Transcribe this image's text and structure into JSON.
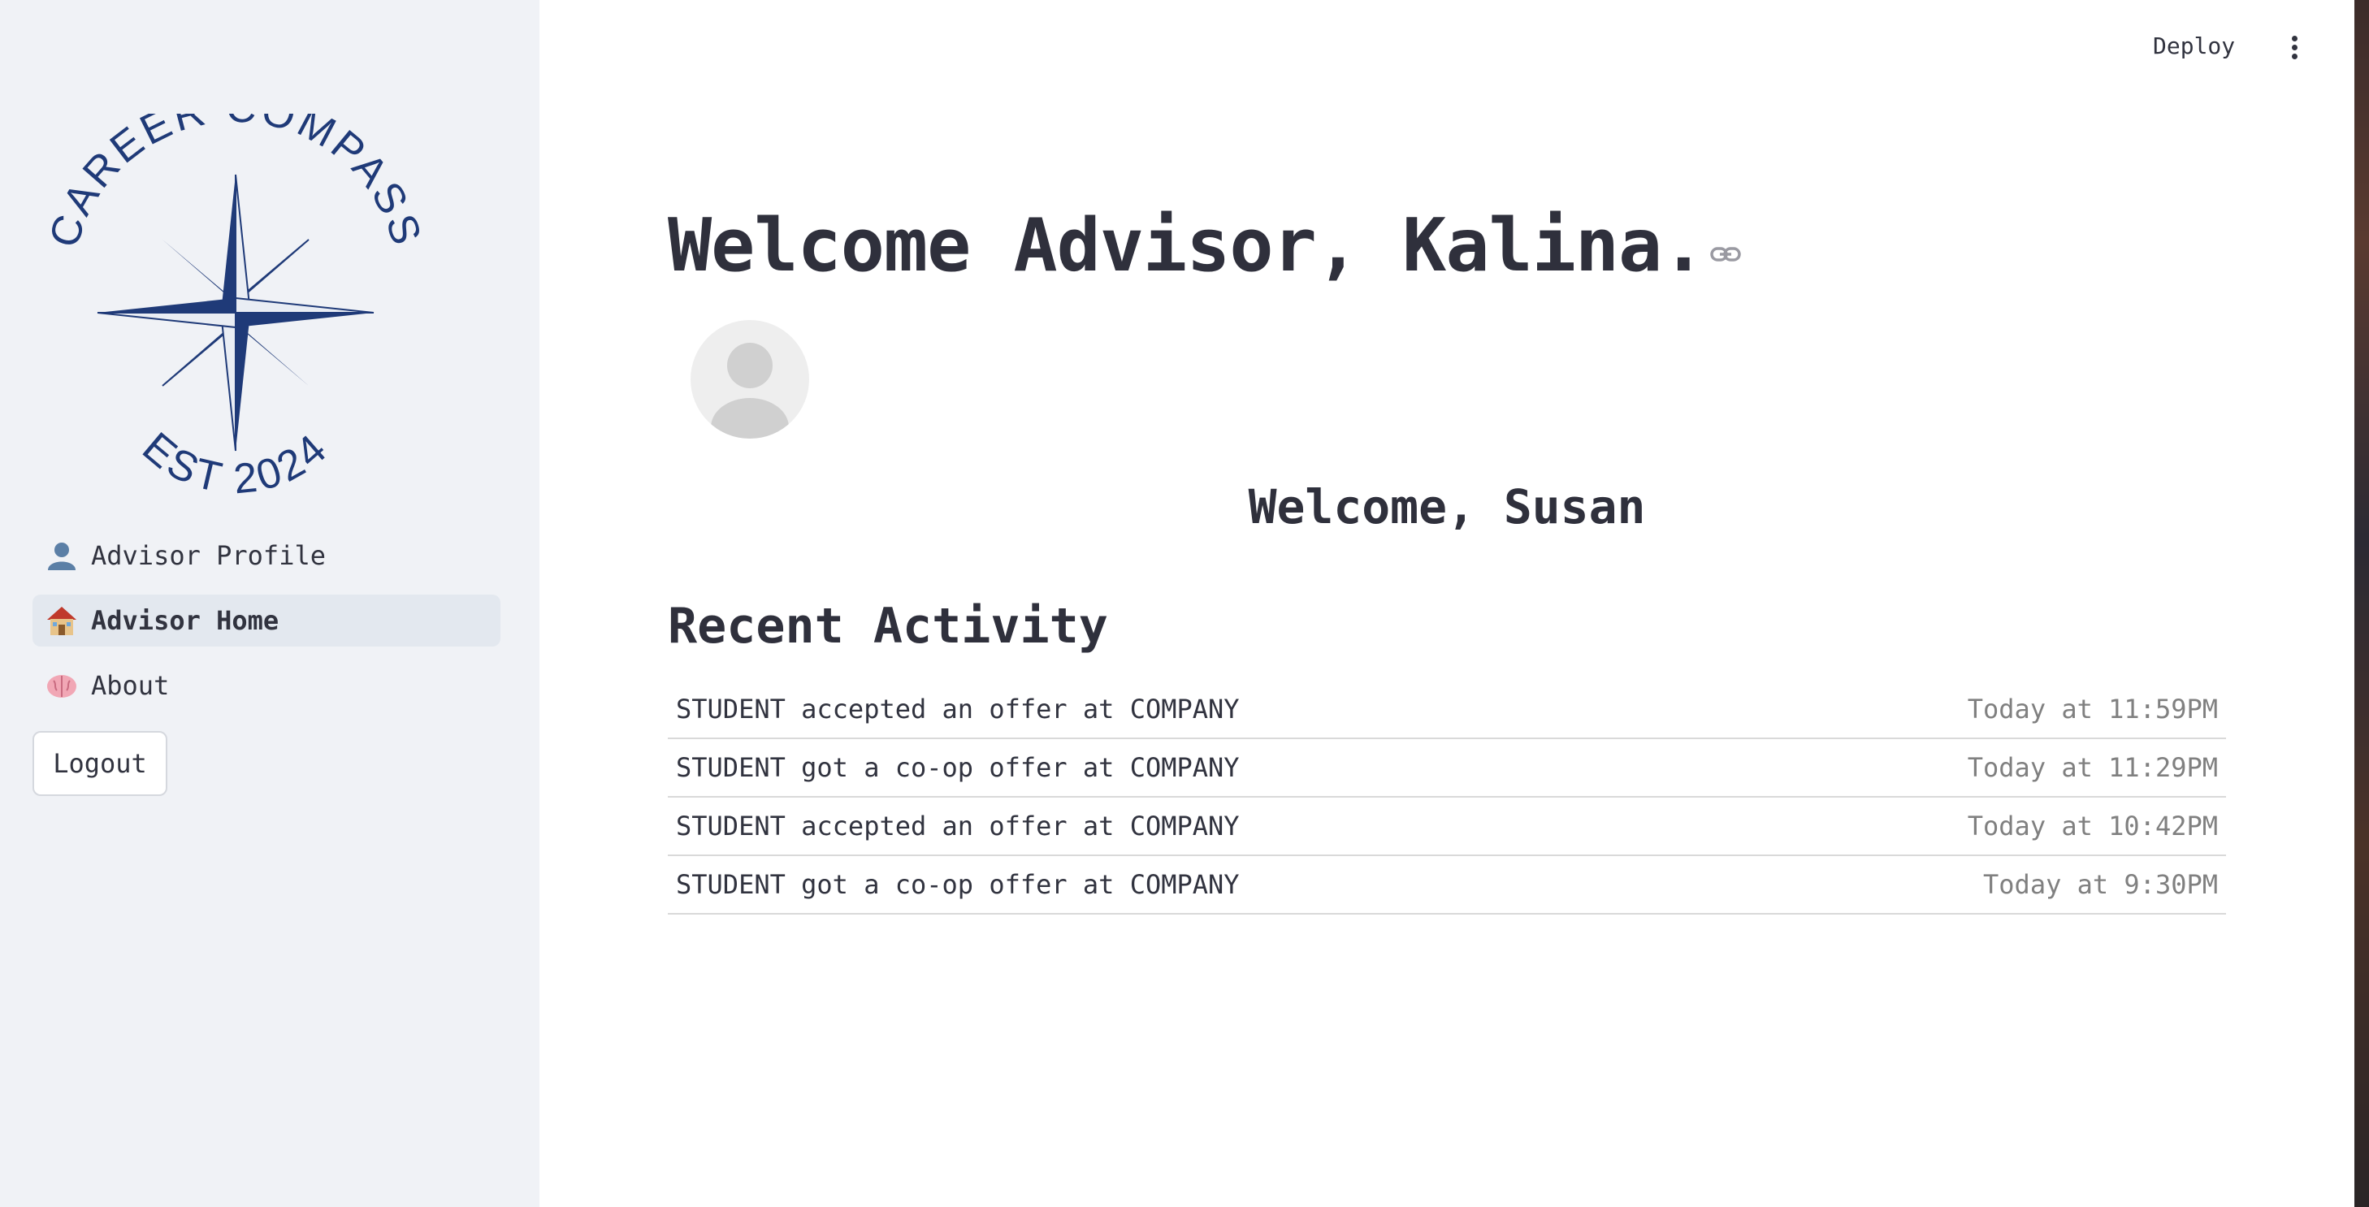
{
  "brand": {
    "logo_text_top": "CAREER COMPASS",
    "logo_text_bottom": "EST 2024",
    "logo_color": "#1f3a78"
  },
  "sidebar": {
    "items": [
      {
        "icon": "bust-in-silhouette-icon",
        "label": "Advisor Profile",
        "active": false
      },
      {
        "icon": "house-icon",
        "label": "Advisor Home",
        "active": true
      },
      {
        "icon": "brain-icon",
        "label": "About",
        "active": false
      }
    ],
    "logout_label": "Logout"
  },
  "toolbar": {
    "deploy_label": "Deploy",
    "menu_icon": "vertical-ellipsis-icon"
  },
  "main": {
    "title": "Welcome Advisor, Kalina.",
    "welcome": "Welcome, Susan",
    "section_title": "Recent Activity",
    "activities": [
      {
        "text": "STUDENT accepted an offer at COMPANY",
        "time": "Today at 11:59PM"
      },
      {
        "text": "STUDENT got a co-op offer at COMPANY",
        "time": "Today at 11:29PM"
      },
      {
        "text": "STUDENT accepted an offer at COMPANY",
        "time": "Today at 10:42PM"
      },
      {
        "text": "STUDENT got a co-op offer at COMPANY",
        "time": "Today at 9:30PM"
      }
    ]
  },
  "colors": {
    "sidebar_bg": "#f0f2f6",
    "active_item_bg": "#e3e8ef",
    "text": "#31333f",
    "muted": "#808080"
  }
}
